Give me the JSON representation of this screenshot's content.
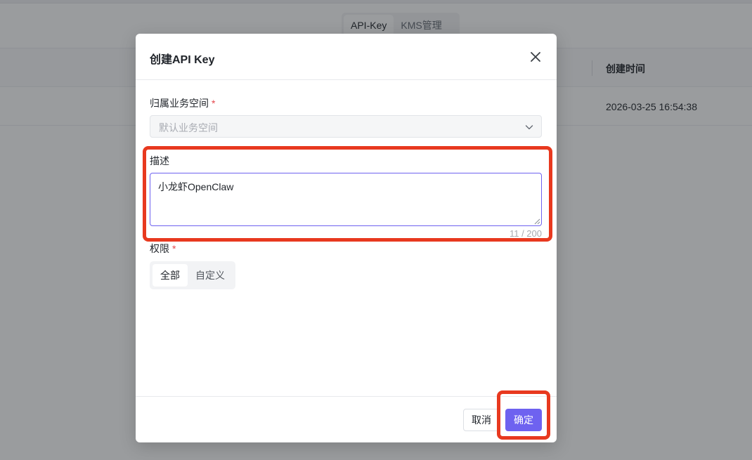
{
  "background": {
    "tabs": [
      {
        "label": "API-Key",
        "active": true
      },
      {
        "label": "KMS管理",
        "active": false
      }
    ],
    "table": {
      "column_header": "创建时间",
      "rows": [
        {
          "created_at": "2026-03-25 16:54:38"
        }
      ]
    }
  },
  "modal": {
    "title": "创建API Key",
    "close_icon": "close-icon",
    "workspace": {
      "label": "归属业务空间",
      "required_mark": "*",
      "placeholder": "默认业务空间",
      "icon": "chevron-down-icon"
    },
    "description": {
      "label": "描述",
      "value": "小龙虾OpenClaw",
      "counter": "11 / 200"
    },
    "permission": {
      "label": "权限",
      "required_mark": "*",
      "options": [
        {
          "label": "全部",
          "active": true
        },
        {
          "label": "自定义",
          "active": false
        }
      ]
    },
    "footer": {
      "cancel_label": "取消",
      "confirm_label": "确定"
    }
  },
  "colors": {
    "primary": "#6e62f0",
    "required": "#e5484d",
    "highlight": "#e8391f"
  }
}
